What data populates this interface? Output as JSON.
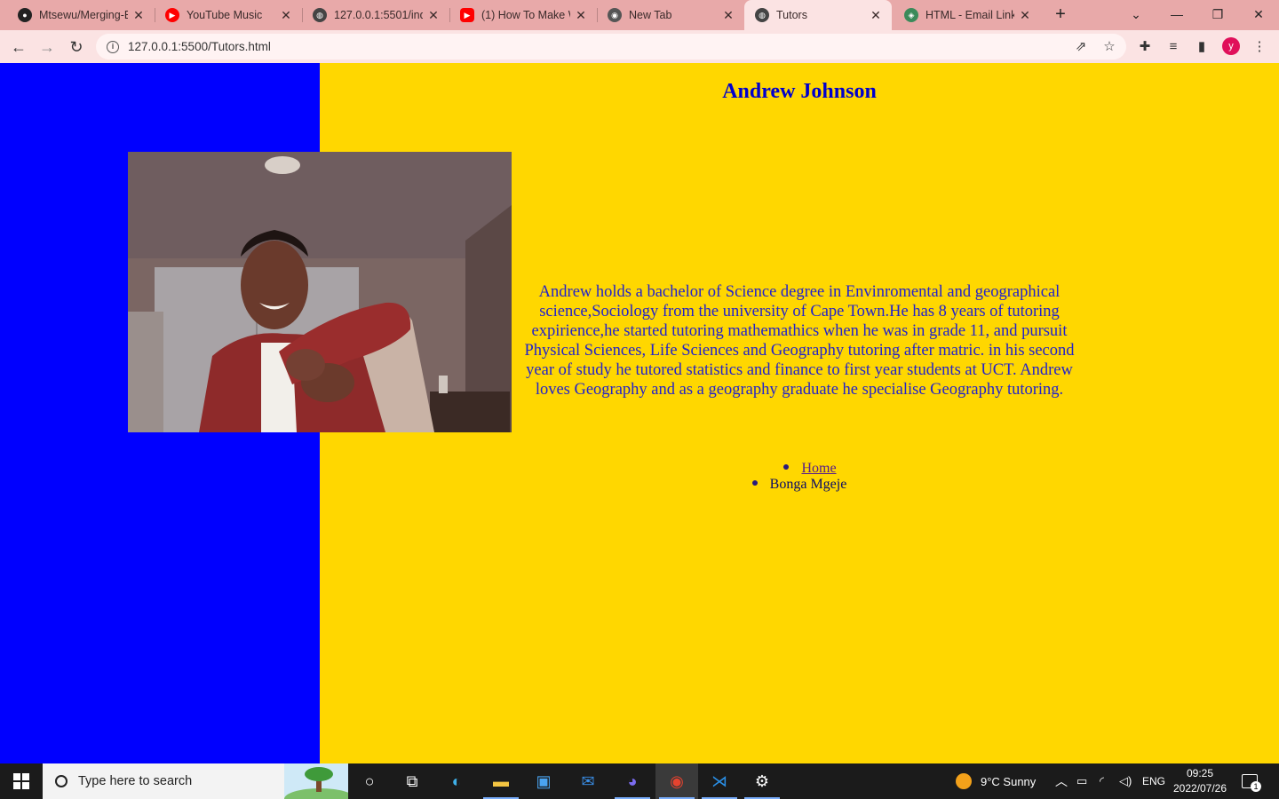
{
  "browser": {
    "tabs": [
      {
        "title": "Mtsewu/Merging-E",
        "icon": "github-icon",
        "color": "#222222"
      },
      {
        "title": "YouTube Music",
        "icon": "youtube-music-icon",
        "color": "#ff0000"
      },
      {
        "title": "127.0.0.1:5501/inde",
        "icon": "globe-icon",
        "color": "#444444"
      },
      {
        "title": "(1) How To Make W",
        "icon": "youtube-icon",
        "color": "#ff0000"
      },
      {
        "title": "New Tab",
        "icon": "chrome-icon",
        "color": "#555555"
      },
      {
        "title": "Tutors",
        "icon": "globe-icon",
        "color": "#444444",
        "active": true
      },
      {
        "title": "HTML - Email Links",
        "icon": "tutorialspoint-icon",
        "color": "#3b8a5a"
      }
    ],
    "close_glyph": "✕",
    "new_tab_glyph": "+",
    "url": "127.0.0.1:5500/Tutors.html",
    "profile_initial": "y",
    "profile_color": "#e0105a"
  },
  "page": {
    "heading": "Andrew Johnson",
    "bio": "Andrew holds a bachelor of Science degree in Envinromental and geographical science,Sociology from the university of Cape Town.He has 8 years of tutoring expirience,he started tutoring mathemathics when he was in grade 11, and pursuit Physical Sciences, Life Sciences and Geography tutoring after matric. in his second year of study he tutored statistics and finance to first year students at UCT. Andrew loves Geography and as a geography graduate he specialise Geography tutoring.",
    "nav": [
      {
        "label": "Home",
        "link": true
      },
      {
        "label": "Bonga Mgeje",
        "link": false
      }
    ],
    "colors": {
      "left_panel": "#0000ff",
      "background": "#ffd700",
      "heading": "#0000cc",
      "text": "#2222cc"
    }
  },
  "taskbar": {
    "search_placeholder": "Type here to search",
    "weather": "9°C  Sunny",
    "language": "ENG",
    "time": "09:25",
    "date": "2022/07/26",
    "notification_count": "1"
  }
}
